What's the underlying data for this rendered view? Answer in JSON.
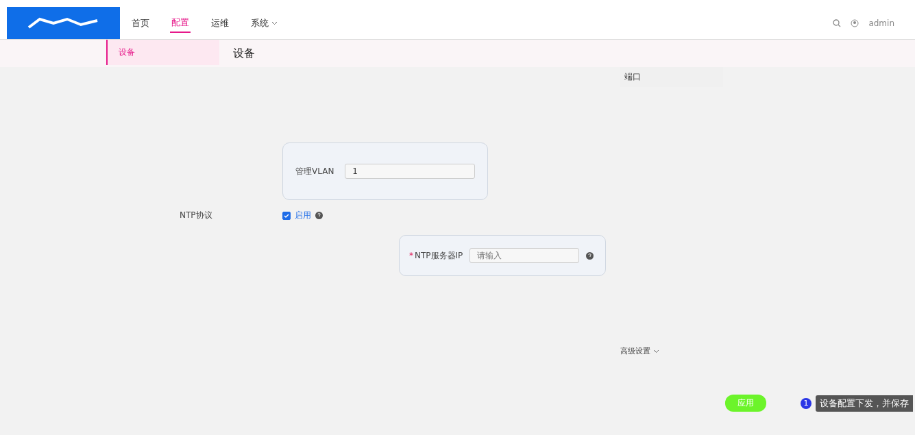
{
  "nav": {
    "items": [
      {
        "label": "首页",
        "selected": false
      },
      {
        "label": "配置",
        "selected": true
      },
      {
        "label": "运维",
        "selected": false
      },
      {
        "label": "系统",
        "selected": false
      }
    ],
    "user": "admin"
  },
  "sidebar": {
    "items": [
      {
        "label": "设备",
        "selected": true
      }
    ]
  },
  "page_title": "设备",
  "port_panel": {
    "title": "端口"
  },
  "form": {
    "vlan": {
      "label": "管理VLAN",
      "value": "1"
    },
    "ntp": {
      "label": "NTP协议",
      "enabled": true,
      "enable_label": "启用",
      "required_mark": "*",
      "server_label": "NTP服务器IP",
      "placeholder": "请输入"
    },
    "advanced": "高级设置"
  },
  "apply_button": "应用",
  "guide": {
    "step": "1",
    "text": "设备配置下发，并保存"
  }
}
